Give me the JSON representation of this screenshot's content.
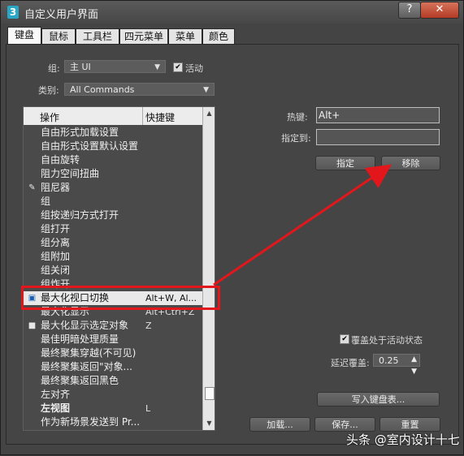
{
  "window": {
    "title": "自定义用户界面",
    "app_icon": "3",
    "help_glyph": "?",
    "close_glyph": "✕"
  },
  "tabs": [
    "键盘",
    "鼠标",
    "工具栏",
    "四元菜单",
    "菜单",
    "颜色"
  ],
  "group": {
    "label": "组:",
    "value": "主 UI",
    "active_label": "活动",
    "active_checked": true
  },
  "category": {
    "label": "类别:",
    "value": "All Commands"
  },
  "list": {
    "header_action": "操作",
    "header_shortcut": "快捷键",
    "rows": [
      {
        "name": "自由形式加载设置",
        "key": ""
      },
      {
        "name": "自由形式设置默认设置",
        "key": ""
      },
      {
        "name": "自由旋转",
        "key": ""
      },
      {
        "name": "阻力空间扭曲",
        "key": ""
      },
      {
        "name": "阻尼器",
        "key": "",
        "icon": "damper-icon"
      },
      {
        "name": "组",
        "key": ""
      },
      {
        "name": "组按递归方式打开",
        "key": ""
      },
      {
        "name": "组打开",
        "key": ""
      },
      {
        "name": "组分离",
        "key": ""
      },
      {
        "name": "组附加",
        "key": ""
      },
      {
        "name": "组关闭",
        "key": ""
      },
      {
        "name": "组炸开",
        "key": ""
      },
      {
        "name": "最大化视口切换",
        "key": "Alt+W, Al...",
        "selected": true,
        "icon": "maximize-viewport-icon"
      },
      {
        "name": "最大化显示",
        "key": "Alt+Ctrl+Z"
      },
      {
        "name": "最大化显示选定对象",
        "key": "Z",
        "icon": "zoom-extents-icon"
      },
      {
        "name": "最佳明暗处理质量",
        "key": ""
      },
      {
        "name": "最终聚集穿越(不可见)",
        "key": ""
      },
      {
        "name": "最终聚集返回\"对象...",
        "key": ""
      },
      {
        "name": "最终聚集返回黑色",
        "key": ""
      },
      {
        "name": "左对齐",
        "key": ""
      },
      {
        "name": "左视图",
        "key": "L",
        "bold": true
      },
      {
        "name": "作为新场景发送到 Pr...",
        "key": ""
      }
    ]
  },
  "hotkey": {
    "label": "热键:",
    "value": "Alt+"
  },
  "assigned_to": {
    "label": "指定到:",
    "value": ""
  },
  "buttons": {
    "assign": "指定",
    "remove": "移除",
    "write_keyboard_chart": "写入键盘表...",
    "load": "加载...",
    "save": "保存...",
    "reset": "重置"
  },
  "override": {
    "label": "覆盖处于活动状态",
    "checked": true
  },
  "delay_override": {
    "label": "延迟覆盖:",
    "value": "0.25"
  },
  "watermark": "头条 @室内设计十七",
  "colors": {
    "highlight": "#e3171b",
    "window_bg": "#444444"
  }
}
